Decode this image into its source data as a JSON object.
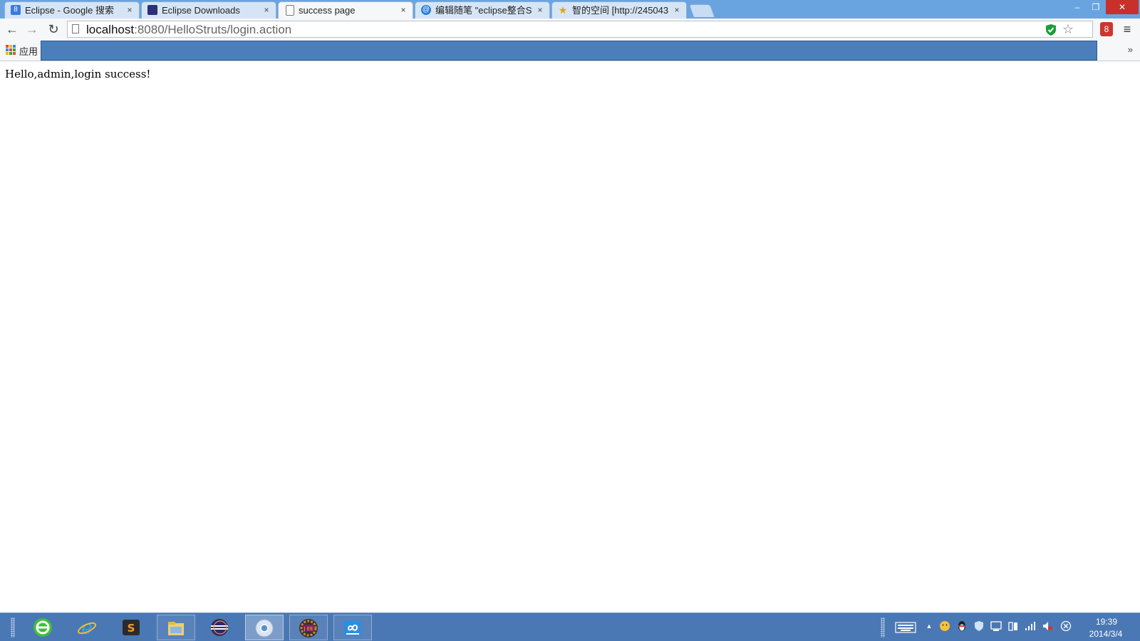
{
  "browser": {
    "tabs": [
      {
        "title": "Eclipse - Google 搜索",
        "favicon": "google-search-icon",
        "active": false
      },
      {
        "title": "Eclipse Downloads",
        "favicon": "eclipse-icon",
        "active": false
      },
      {
        "title": "success page",
        "favicon": "page-icon",
        "active": true
      },
      {
        "title": "编辑随笔 \"eclipse整合St",
        "favicon": "blog-icon",
        "active": false
      },
      {
        "title": "智的空间 [http://245043",
        "favicon": "star-icon",
        "active": false
      }
    ],
    "close_glyph": "×",
    "window_controls": {
      "minimize": "–",
      "restore": "❐",
      "close": "✕"
    },
    "nav": {
      "back": "←",
      "forward": "→",
      "reload": "↻"
    },
    "url": {
      "host": "localhost",
      "rest": ":8080/HelloStruts/login.action"
    },
    "bookmarks": {
      "apps_label": "应用",
      "overflow": "»"
    },
    "colors": {
      "titlebar": "#6aa4e0",
      "bookmark_highlight": "#4a7fbc",
      "taskbar": "#4a78b4"
    }
  },
  "page": {
    "message": "Hello,admin,login success!"
  },
  "taskbar": {
    "apps": [
      {
        "name": "360-browser-icon",
        "state": "normal"
      },
      {
        "name": "internet-explorer-icon",
        "state": "normal"
      },
      {
        "name": "sublime-text-icon",
        "state": "normal"
      },
      {
        "name": "file-explorer-icon",
        "state": "framed"
      },
      {
        "name": "eclipse-icon",
        "state": "normal"
      },
      {
        "name": "chrome-icon",
        "state": "active"
      },
      {
        "name": "java-ee-ide-icon",
        "state": "framed"
      },
      {
        "name": "baidu-cloud-icon",
        "state": "framed"
      }
    ],
    "clock": {
      "time": "19:39",
      "date": "2014/3/4"
    }
  }
}
